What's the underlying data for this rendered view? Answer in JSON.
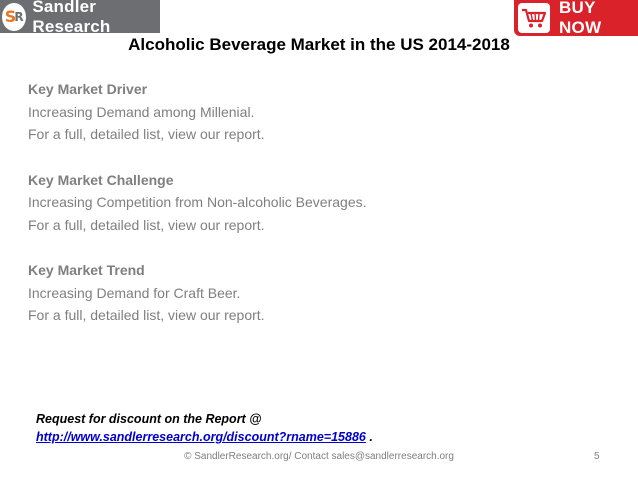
{
  "logo": {
    "mark_s": "S",
    "mark_r": "R",
    "text": "Sandler Research"
  },
  "buy_now": {
    "label": "BUY NOW",
    "icon": "shopping-cart-icon"
  },
  "title": "Alcoholic Beverage Market in the US 2014-2018",
  "sections": [
    {
      "heading": "Key Market Driver",
      "text": "Increasing Demand among Millenial.",
      "note": "For a full, detailed list, view our report."
    },
    {
      "heading": "Key Market Challenge",
      "text": "Increasing Competition from Non-alcoholic Beverages.",
      "note": "For a full, detailed list, view our report."
    },
    {
      "heading": "Key Market Trend",
      "text": "Increasing Demand for Craft Beer.",
      "note": "For a full, detailed list, view our report."
    }
  ],
  "discount": {
    "label": "Request for discount on the Report @",
    "link": "http://www.sandlerresearch.org/discount?rname=15886",
    "suffix": " ."
  },
  "footer": {
    "text": "© SandlerResearch.org/ Contact  sales@sandlerresearch.org",
    "page_number": "5"
  },
  "colors": {
    "logo_bg": "#6d6e71",
    "logo_accent": "#e87722",
    "buy_now_bg": "#d9222a",
    "body_text": "#7f7f7f",
    "link": "#0000cc"
  }
}
